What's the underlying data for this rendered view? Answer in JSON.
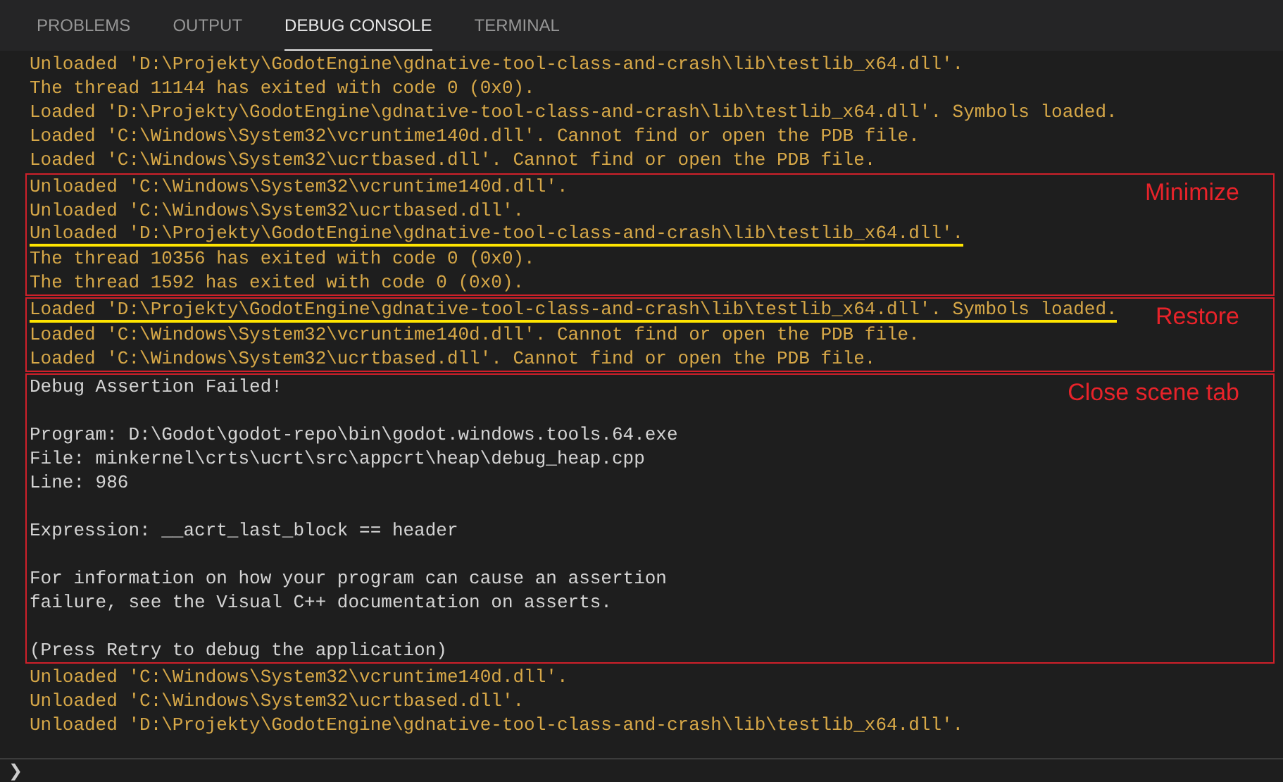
{
  "tabs": [
    {
      "label": "PROBLEMS",
      "selected": false
    },
    {
      "label": "OUTPUT",
      "selected": false
    },
    {
      "label": "DEBUG CONSOLE",
      "selected": true
    },
    {
      "label": "TERMINAL",
      "selected": false
    }
  ],
  "console": [
    {
      "kind": "plain",
      "paragraphs": [
        [
          {
            "text": "Unloaded 'D:\\Projekty\\GodotEngine\\gdnative-tool-class-and-crash\\lib\\testlib_x64.dll'.",
            "kind": "output",
            "underlined": false
          },
          {
            "text": "The thread 11144 has exited with code 0 (0x0).",
            "kind": "output",
            "underlined": false
          },
          {
            "text": "Loaded 'D:\\Projekty\\GodotEngine\\gdnative-tool-class-and-crash\\lib\\testlib_x64.dll'. Symbols loaded.",
            "kind": "output",
            "underlined": false
          },
          {
            "text": "Loaded 'C:\\Windows\\System32\\vcruntime140d.dll'. Cannot find or open the PDB file.",
            "kind": "output",
            "underlined": false
          },
          {
            "text": "Loaded 'C:\\Windows\\System32\\ucrtbased.dll'. Cannot find or open the PDB file.",
            "kind": "output",
            "underlined": false
          }
        ]
      ]
    },
    {
      "kind": "boxed",
      "note": "Minimize",
      "paragraphs": [
        [
          {
            "text": "Unloaded 'C:\\Windows\\System32\\vcruntime140d.dll'.",
            "kind": "output",
            "underlined": false
          },
          {
            "text": "Unloaded 'C:\\Windows\\System32\\ucrtbased.dll'.",
            "kind": "output",
            "underlined": false
          },
          {
            "text": "Unloaded 'D:\\Projekty\\GodotEngine\\gdnative-tool-class-and-crash\\lib\\testlib_x64.dll'.",
            "kind": "output",
            "underlined": true
          },
          {
            "text": "The thread 10356 has exited with code 0 (0x0).",
            "kind": "output",
            "underlined": false
          },
          {
            "text": "The thread 1592 has exited with code 0 (0x0).",
            "kind": "output",
            "underlined": false
          }
        ]
      ]
    },
    {
      "kind": "boxed",
      "note": "Restore",
      "paragraphs": [
        [
          {
            "text": "Loaded 'D:\\Projekty\\GodotEngine\\gdnative-tool-class-and-crash\\lib\\testlib_x64.dll'. Symbols loaded.",
            "kind": "output",
            "underlined": true
          },
          {
            "text": "Loaded 'C:\\Windows\\System32\\vcruntime140d.dll'. Cannot find or open the PDB file.",
            "kind": "output",
            "underlined": false
          },
          {
            "text": "Loaded 'C:\\Windows\\System32\\ucrtbased.dll'. Cannot find or open the PDB file.",
            "kind": "output",
            "underlined": false
          }
        ]
      ]
    },
    {
      "kind": "boxed",
      "note": "Close scene tab",
      "paragraphs": [
        [
          {
            "text": "Debug Assertion Failed!",
            "kind": "assertion",
            "underlined": false
          }
        ],
        [
          {
            "text": "Program: D:\\Godot\\godot-repo\\bin\\godot.windows.tools.64.exe",
            "kind": "assertion",
            "underlined": false
          },
          {
            "text": "File: minkernel\\crts\\ucrt\\src\\appcrt\\heap\\debug_heap.cpp",
            "kind": "assertion",
            "underlined": false
          },
          {
            "text": "Line: 986",
            "kind": "assertion",
            "underlined": false
          }
        ],
        [
          {
            "text": "Expression: __acrt_last_block == header",
            "kind": "assertion",
            "underlined": false
          }
        ],
        [
          {
            "text": "For information on how your program can cause an assertion",
            "kind": "assertion",
            "underlined": false
          },
          {
            "text": "failure, see the Visual C++ documentation on asserts.",
            "kind": "assertion",
            "underlined": false
          }
        ],
        [
          {
            "text": "(Press Retry to debug the application)",
            "kind": "assertion",
            "underlined": false
          }
        ]
      ]
    },
    {
      "kind": "plain",
      "paragraphs": [
        [
          {
            "text": "Unloaded 'C:\\Windows\\System32\\vcruntime140d.dll'.",
            "kind": "output",
            "underlined": false
          },
          {
            "text": "Unloaded 'C:\\Windows\\System32\\ucrtbased.dll'.",
            "kind": "output",
            "underlined": false
          },
          {
            "text": "Unloaded 'D:\\Projekty\\GodotEngine\\gdnative-tool-class-and-crash\\lib\\testlib_x64.dll'.",
            "kind": "output",
            "underlined": false
          }
        ]
      ]
    }
  ],
  "prompt": "❯"
}
